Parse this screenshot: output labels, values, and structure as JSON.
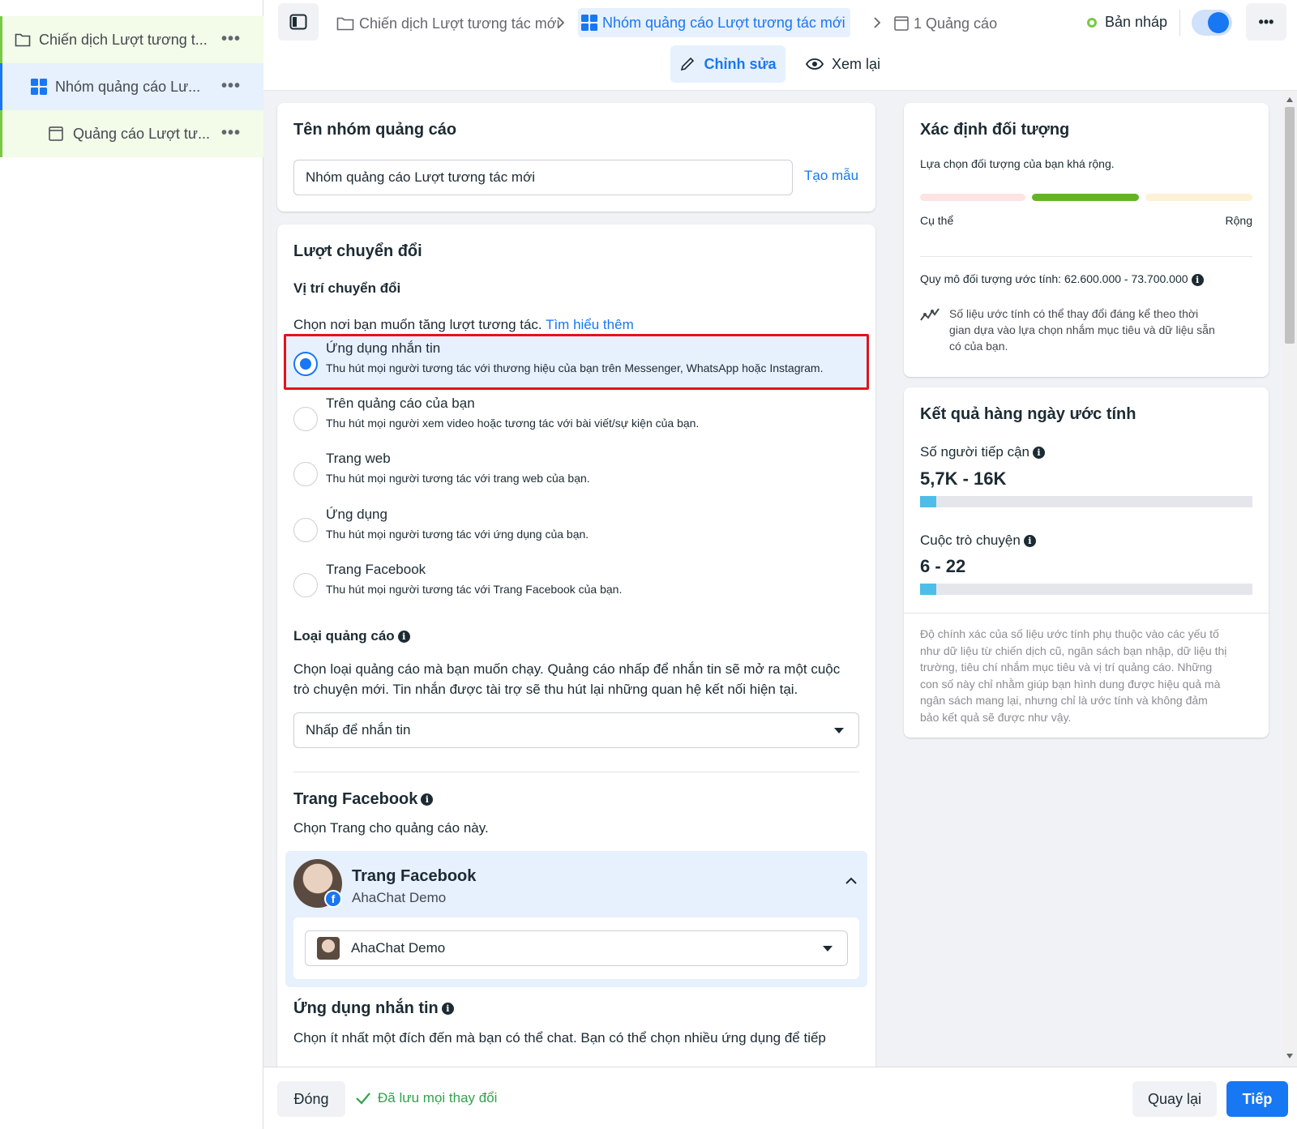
{
  "tree": {
    "campaign": "Chiến dịch Lượt tương t...",
    "adset": "Nhóm quảng cáo Lư...",
    "ad": "Quảng cáo Lượt tư...",
    "more": "•••"
  },
  "topbar": {
    "crumb_campaign": "Chiến dịch Lượt tương tác mới",
    "crumb_adset": "Nhóm quảng cáo Lượt tương tác mới",
    "crumb_ad": "1 Quảng cáo",
    "status": "Bản nháp",
    "edit_label": "Chỉnh sửa",
    "review_label": "Xem lại",
    "more": "•••"
  },
  "adset_name": {
    "title": "Tên nhóm quảng cáo",
    "value": "Nhóm quảng cáo Lượt tương tác mới",
    "template_link": "Tạo mẫu"
  },
  "conversion": {
    "title": "Lượt chuyển đổi",
    "location_label": "Vị trí chuyển đổi",
    "prompt": "Chọn nơi bạn muốn tăng lượt tương tác.",
    "learn_more": "Tìm hiểu thêm",
    "options": [
      {
        "title": "Ứng dụng nhắn tin",
        "desc": "Thu hút mọi người tương tác với thương hiệu của bạn trên Messenger, WhatsApp hoặc Instagram.",
        "selected": true
      },
      {
        "title": "Trên quảng cáo của bạn",
        "desc": "Thu hút mọi người xem video hoặc tương tác với bài viết/sự kiện của bạn.",
        "selected": false
      },
      {
        "title": "Trang web",
        "desc": "Thu hút mọi người tương tác với trang web của bạn.",
        "selected": false
      },
      {
        "title": "Ứng dụng",
        "desc": "Thu hút mọi người tương tác với ứng dụng của bạn.",
        "selected": false
      },
      {
        "title": "Trang Facebook",
        "desc": "Thu hút mọi người tương tác với Trang Facebook của bạn.",
        "selected": false
      }
    ],
    "ad_type_label": "Loại quảng cáo",
    "ad_type_desc_1": "Chọn loại quảng cáo mà bạn muốn chạy. Quảng cáo nhấp để nhắn tin sẽ mở ra một cuộc",
    "ad_type_desc_2": "trò chuyện mới. Tin nhắn được tài trợ sẽ thu hút lại những quan hệ kết nối hiện tại.",
    "ad_type_value": "Nhấp để nhắn tin",
    "fb_page_label": "Trang Facebook",
    "fb_page_desc": "Chọn Trang cho quảng cáo này.",
    "fb_page_card_title": "Trang Facebook",
    "fb_page_card_sub": "AhaChat Demo",
    "fb_page_select": "AhaChat Demo",
    "messaging_label": "Ứng dụng nhắn tin",
    "messaging_desc": "Chọn ít nhất một đích đến mà bạn có thể chat. Bạn có thể chọn nhiều ứng dụng để tiếp"
  },
  "audience": {
    "title": "Xác định đối tượng",
    "desc": "Lựa chọn đối tượng của bạn khá rộng.",
    "specific": "Cụ thể",
    "broad": "Rộng",
    "size": "Quy mô đối tượng ước tính: 62.600.000 - 73.700.000",
    "note_1": "Số liệu ước tính có thể thay đổi đáng kể theo thời",
    "note_2": "gian dựa vào lựa chọn nhắm mục tiêu và dữ liệu sẵn",
    "note_3": "có của bạn."
  },
  "results": {
    "title": "Kết quả hàng ngày ước tính",
    "reach_label": "Số người tiếp cận",
    "reach_value": "5,7K - 16K",
    "conv_label": "Cuộc trò chuyện",
    "conv_value": "6 - 22",
    "disclaimer": [
      "Độ chính xác của số liệu ước tính phụ thuộc vào các yếu tố",
      "như dữ liệu từ chiến dịch cũ, ngân sách bạn nhập, dữ liệu thị",
      "trường, tiêu chí nhắm mục tiêu và vị trí quảng cáo. Những",
      "con số này chỉ nhằm giúp bạn hình dung được hiệu quả mà",
      "ngân sách mang lại, nhưng chỉ là ước tính và không đảm",
      "bảo kết quả sẽ được như vậy."
    ]
  },
  "footer": {
    "close": "Đóng",
    "saved": "Đã lưu mọi thay đổi",
    "back": "Quay lại",
    "next": "Tiếp"
  },
  "colors": {
    "accent": "#1877f2",
    "highlight_border": "#e4131b",
    "green": "#7ac943"
  }
}
